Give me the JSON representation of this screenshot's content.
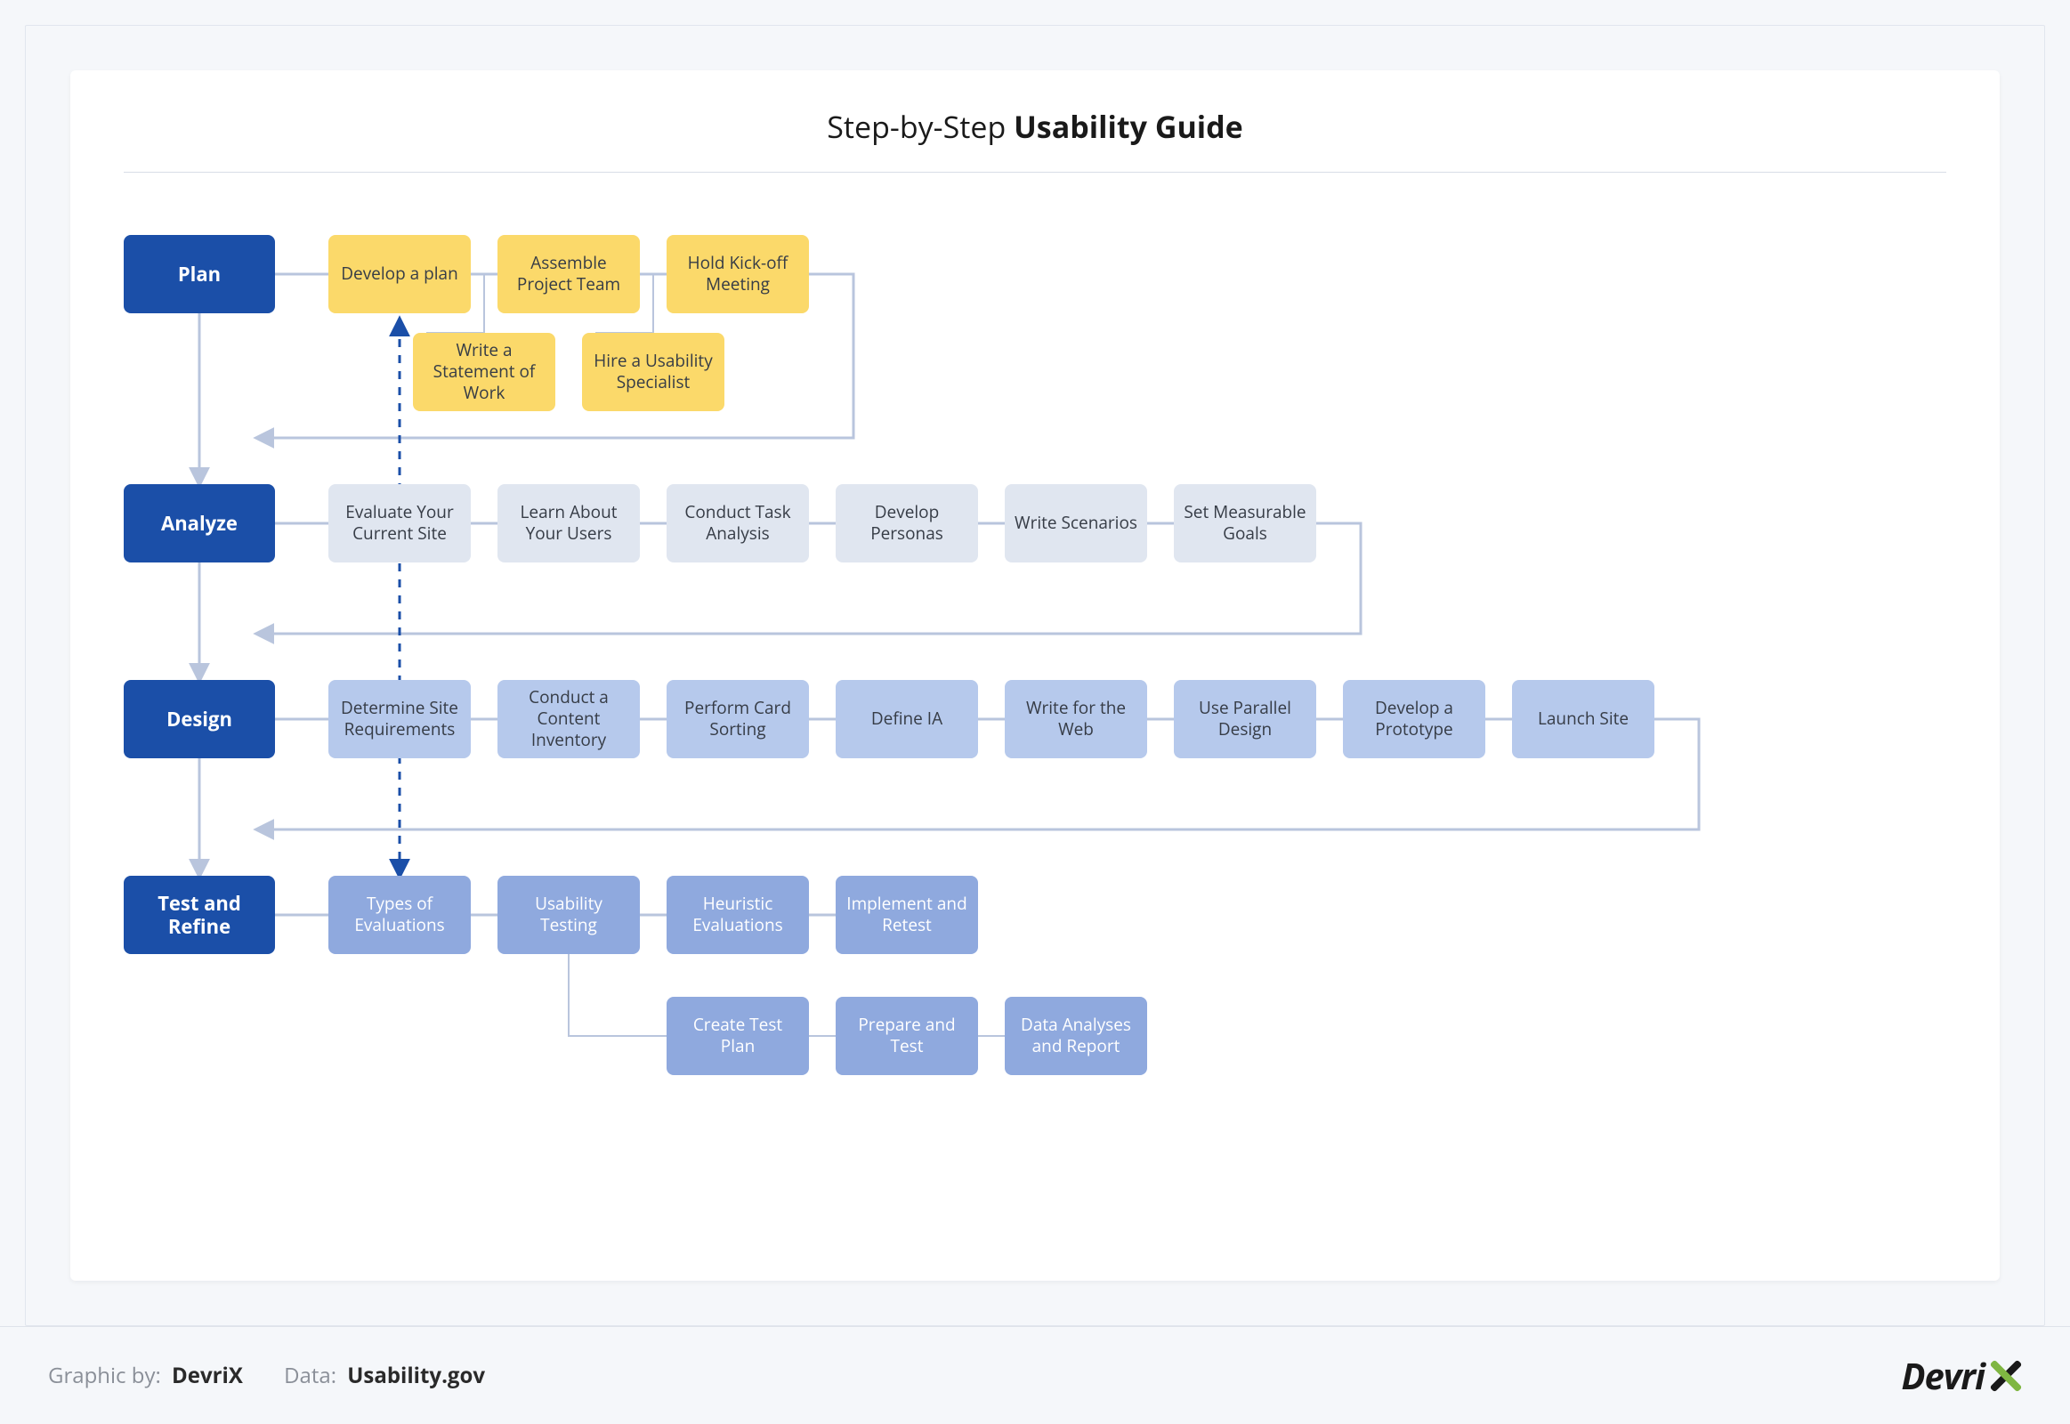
{
  "title_prefix": "Step-by-Step ",
  "title_bold": "Usability Guide",
  "phases": {
    "plan": {
      "label": "Plan"
    },
    "analyze": {
      "label": "Analyze"
    },
    "design": {
      "label": "Design"
    },
    "test": {
      "label": "Test and Refine"
    }
  },
  "plan_row1": {
    "n0": "Develop a plan",
    "n1": "Assemble Project Team",
    "n2": "Hold Kick-off Meeting"
  },
  "plan_row2": {
    "n0": "Write a Statement of Work",
    "n1": "Hire a Usability Specialist"
  },
  "analyze_row": {
    "n0": "Evaluate Your Current Site",
    "n1": "Learn About Your Users",
    "n2": "Conduct Task Analysis",
    "n3": "Develop Personas",
    "n4": "Write Scenarios",
    "n5": "Set Measurable Goals"
  },
  "design_row": {
    "n0": "Determine Site Requirements",
    "n1": "Conduct a Content Inventory",
    "n2": "Perform Card Sorting",
    "n3": "Define IA",
    "n4": "Write for the Web",
    "n5": "Use Parallel Design",
    "n6": "Develop a Prototype",
    "n7": "Launch Site"
  },
  "test_row1": {
    "n0": "Types of Evaluations",
    "n1": "Usability Testing",
    "n2": "Heuristic Evaluations",
    "n3": "Implement and Retest"
  },
  "test_row2": {
    "n0": "Create Test Plan",
    "n1": "Prepare and Test",
    "n2": "Data Analyses and Report"
  },
  "footer": {
    "graphic_label": "Graphic by:",
    "graphic_value": "DevriX",
    "data_label": "Data:",
    "data_value": "Usability.gov",
    "logo_text": "Devri"
  },
  "colors": {
    "phase": "#1b4fa8",
    "plan_node": "#fbd96a",
    "analyze_node": "#e0e6f0",
    "design_node": "#b6c9ec",
    "test_node": "#8fa9de",
    "connector": "#b9c5dd",
    "dashed": "#1b4fa8"
  },
  "diagram_structure": {
    "type": "flowchart",
    "phases_sequence": [
      "Plan",
      "Analyze",
      "Design",
      "Test and Refine"
    ],
    "feedback_loop": "Test and Refine loops back to Plan (Develop a plan)"
  }
}
